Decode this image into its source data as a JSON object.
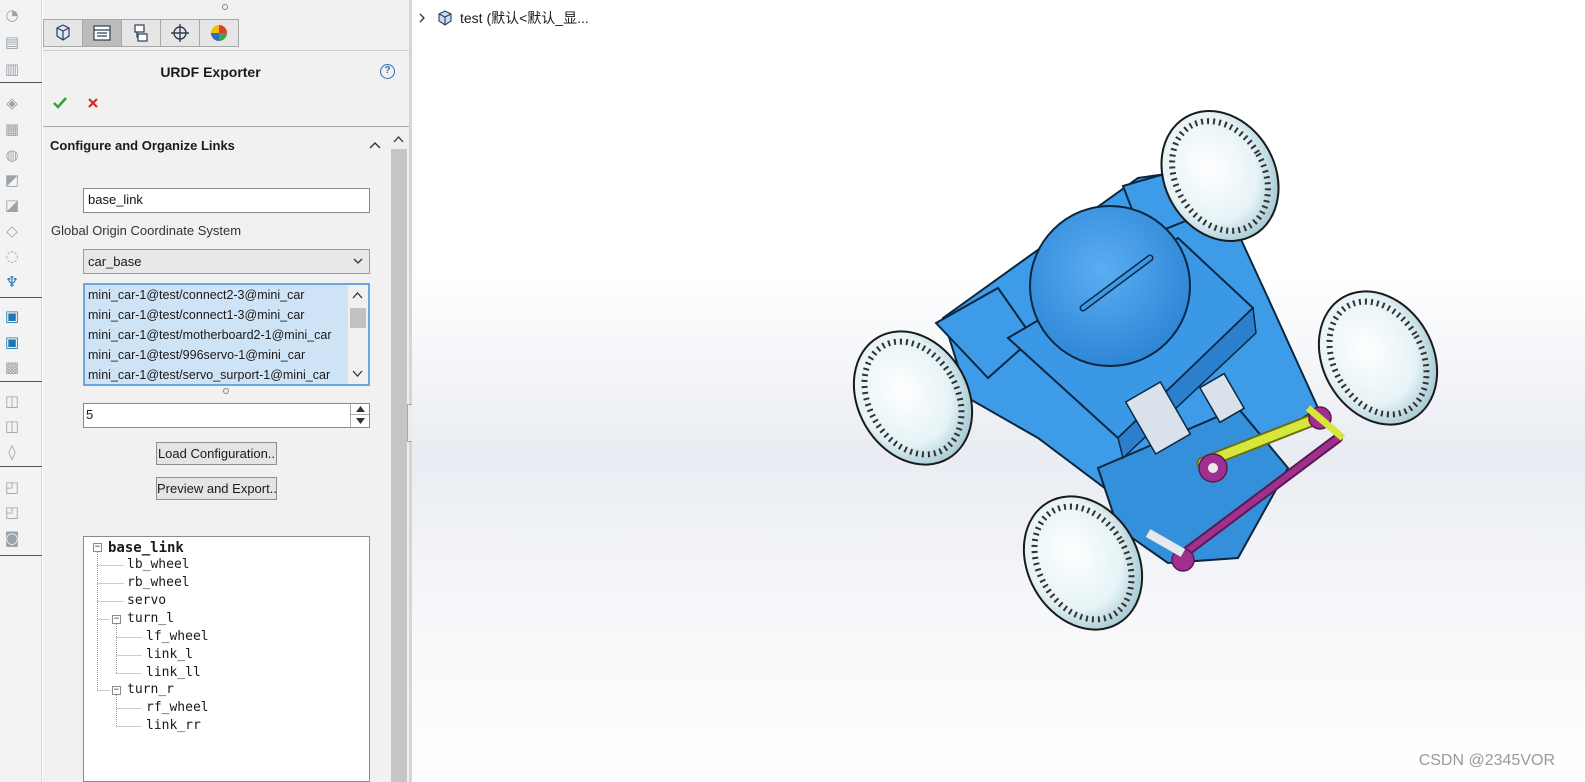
{
  "pm": {
    "title": "URDF Exporter",
    "help_symbol": "?",
    "tabs": [
      "feature-manager-icon",
      "property-manager-icon",
      "configuration-manager-icon",
      "dimxpert-icon",
      "display-manager-icon"
    ]
  },
  "links_group": {
    "title": "Configure and Organize Links",
    "link_name_value": "base_link",
    "origin_label": "Global Origin Coordinate System",
    "origin_selected": "car_base",
    "components": [
      "mini_car-1@test/connect2-3@mini_car",
      "mini_car-1@test/connect1-3@mini_car",
      "mini_car-1@test/motherboard2-1@mini_car",
      "mini_car-1@test/996servo-1@mini_car",
      "mini_car-1@test/servo_surport-1@mini_car"
    ],
    "child_count": "5",
    "load_button": "Load Configuration..",
    "export_button": "Preview and Export.."
  },
  "link_tree": {
    "root": "base_link",
    "n_lb_wheel": "lb_wheel",
    "n_rb_wheel": "rb_wheel",
    "n_servo": "servo",
    "n_turn_l": "turn_l",
    "n_lf_wheel": "lf_wheel",
    "n_link_l": "link_l",
    "n_link_ll": "link_ll",
    "n_turn_r": "turn_r",
    "n_rf_wheel": "rf_wheel",
    "n_link_rr": "link_rr"
  },
  "viewport": {
    "tree_root_label": "test  (默认<默认_显...",
    "watermark": "CSDN @2345VOR"
  },
  "colors": {
    "body_blue": "#3d9be8",
    "accent_yellow": "#d7e63a",
    "accent_purple": "#a0308f",
    "selection_blue": "#cfe3f7"
  }
}
